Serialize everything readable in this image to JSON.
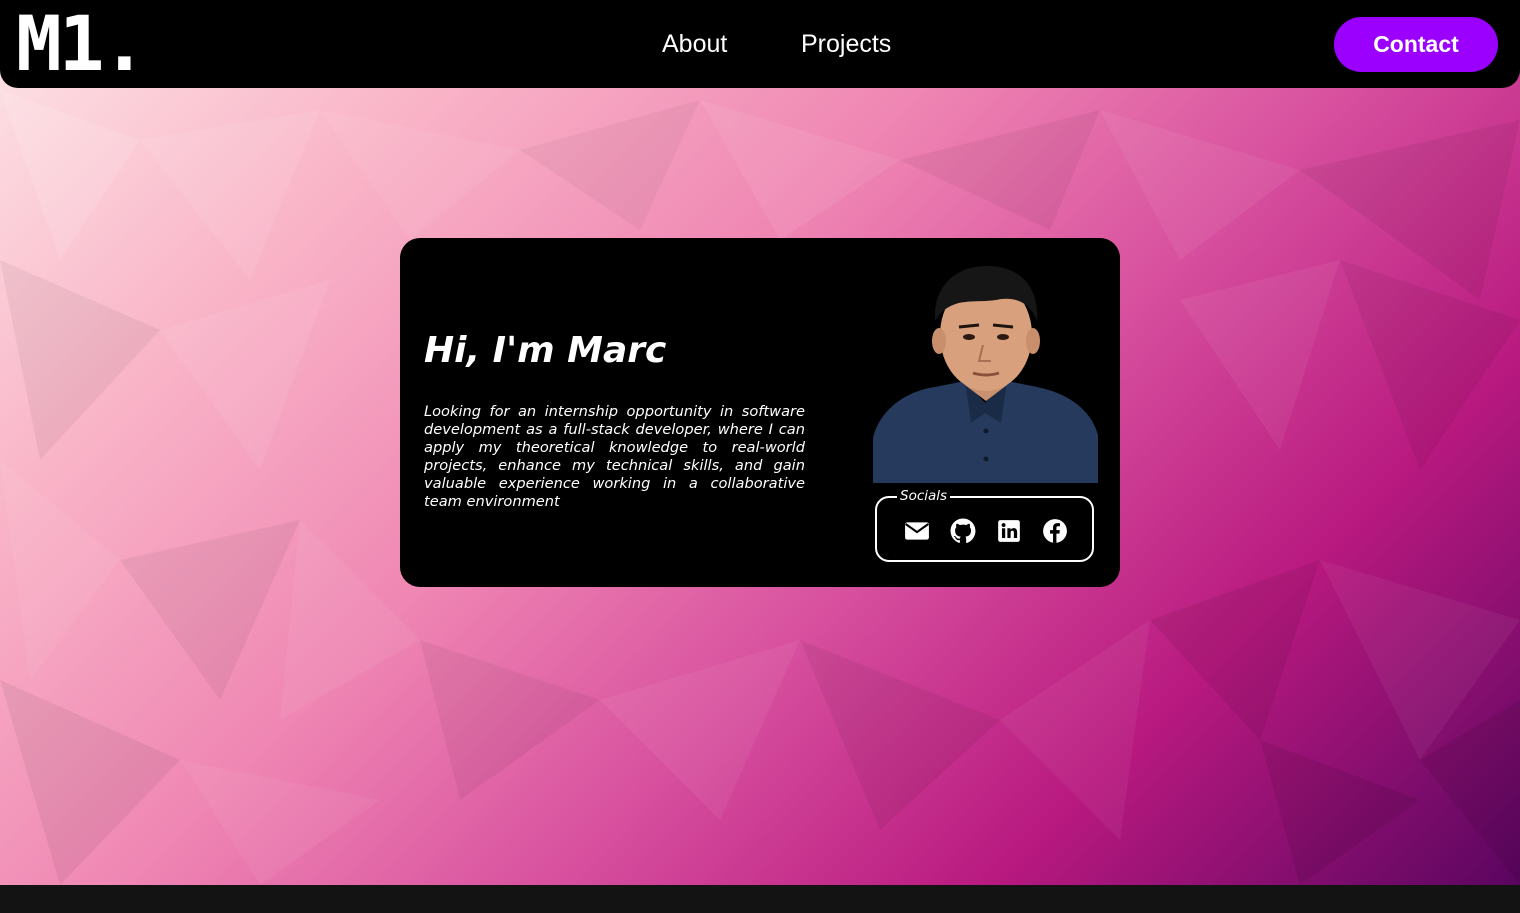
{
  "navbar": {
    "logo": "M1.",
    "links": [
      {
        "label": "About"
      },
      {
        "label": "Projects"
      }
    ],
    "contact_label": "Contact"
  },
  "hero": {
    "title": "Hi, I'm Marc",
    "description": "Looking for an internship opportunity in software development as a full-stack developer, where I can apply my theoretical knowledge to real-world projects, enhance my technical skills, and gain valuable experience working in a collaborative team environment",
    "socials_label": "Socials",
    "socials": [
      {
        "icon": "mail-icon"
      },
      {
        "icon": "github-icon"
      },
      {
        "icon": "linkedin-icon"
      },
      {
        "icon": "facebook-icon"
      }
    ]
  },
  "colors": {
    "accent": "#9b00ff",
    "navbar": "#000000",
    "card": "#000000",
    "text": "#ffffff"
  }
}
